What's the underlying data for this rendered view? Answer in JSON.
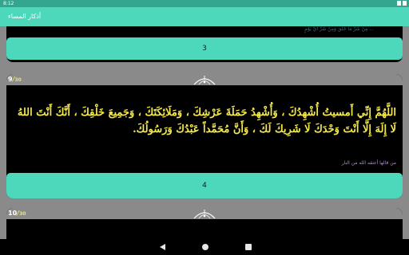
{
  "status_bar": {
    "time": "8:12"
  },
  "app_bar": {
    "title": "أذكار المساء"
  },
  "cards": [
    {
      "faded_text": "... مِنْ شَرِّ مَا خَلَقَ وَمِنْ شَرِّ أَيِّ يَوْمٍ",
      "count": "3"
    },
    {
      "index": "9",
      "total": "30",
      "text": "اللَّهُمَّ إِنِّي أَمسيتُ أُشْهِدُكَ ، وَأُشْهِدُ حَمَلَةَ عَرْشِكَ ، وَمَلَائِكَتَكَ ، وَجَمِيعَ خَلْقِكَ ، أَنَّكَ أَنْتَ اللهُ لَا إِلَهَ إِلَّا أَنْتَ وَحْدَكَ لَا شَرِيكَ لَكَ ، وَأَنَّ مُحَمَّداً عَبْدُكَ وَرَسُولُكَ.",
      "reward": "من قالها أعتقه الله من النار",
      "count": "4"
    },
    {
      "index": "10",
      "total": "30"
    }
  ],
  "colors": {
    "status_bar": "#34a58e",
    "app_bar": "#4dd8bc",
    "dhikr_text": "#f5e94a",
    "reward_text": "#b48adc"
  }
}
